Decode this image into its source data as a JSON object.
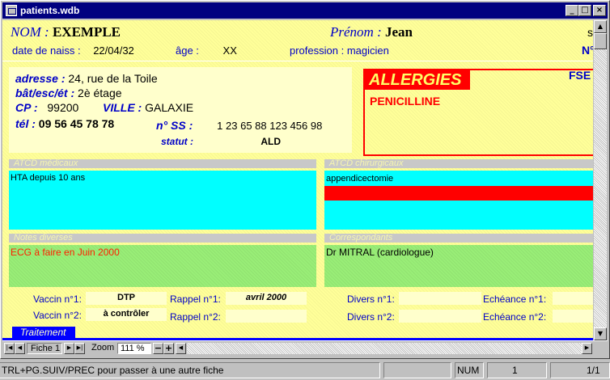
{
  "window": {
    "title": "patients.wdb",
    "min_label": "_",
    "max_label": "□",
    "close_label": "×"
  },
  "header": {
    "nom_label": "NOM :",
    "nom_value": "EXEMPLE",
    "prenom_label": "Prénom :",
    "prenom_value": "Jean",
    "right_cut_1": "s",
    "date_label": "date de naiss :",
    "date_value": "22/04/32",
    "age_label": "âge :",
    "age_value": "XX",
    "profession_label": "profession :",
    "profession_value": "magicien",
    "right_cut_2": "N°"
  },
  "address": {
    "adresse_label": "adresse :",
    "adresse_value": "24, rue de la Toile",
    "bat_label": "bât/esc/ét :",
    "bat_value": "2è étage",
    "cp_label": "CP :",
    "cp_value": "99200",
    "ville_label": "VILLE :",
    "ville_value": "GALAXIE",
    "tel_label": "tél :",
    "tel_value": "09 56 45 78 78",
    "ss_label": "n° SS :",
    "ss_value": "1 23 65 88 123 456 98",
    "statut_label": "statut :",
    "statut_value": "ALD"
  },
  "allergies": {
    "title": "ALLERGIES",
    "value": "PENICILLINE",
    "fse_label": "FSE"
  },
  "sections": {
    "atcd_medicaux_label": "ATCD médicaux",
    "atcd_medicaux_value": "HTA depuis 10 ans",
    "atcd_chir_label": "ATCD chirurgicaux",
    "atcd_chir_value": "appendicectomie",
    "notes_label": "Notes diverses",
    "notes_value": "ECG à faire en Juin 2000",
    "correspondants_label": "Correspondants",
    "correspondants_value": "Dr MITRAL (cardiologue)"
  },
  "vaccins": {
    "vaccin1_label": "Vaccin n°1:",
    "vaccin1_value": "DTP",
    "vaccin2_label": "Vaccin n°2:",
    "vaccin2_value": "à contrôler",
    "rappel1_label": "Rappel n°1:",
    "rappel1_value": "avril 2000",
    "rappel2_label": "Rappel n°2:",
    "rappel2_value": "",
    "divers1_label": "Divers n°1:",
    "divers2_label": "Divers n°2:",
    "echeance1_label": "Echéance n°1:",
    "echeance2_label": "Echéance n°2:"
  },
  "traitement_tab": "Traitement",
  "navbar": {
    "fiche_label": "Fiche 1",
    "zoom_label": "Zoom",
    "zoom_value": "111 %",
    "zoom_minus": "−",
    "zoom_plus": "+"
  },
  "statusbar": {
    "message": "TRL+PG.SUIV/PREC pour passer à une autre fiche",
    "num": "NUM",
    "page": "1",
    "pages": "1/1"
  },
  "colors": {
    "title_bar": "#000080",
    "form_bg": "#ffff99",
    "label_blue": "#0000c8",
    "allergy_red": "#ff0000",
    "cyan": "#00ffff",
    "green": "#99ee77"
  }
}
